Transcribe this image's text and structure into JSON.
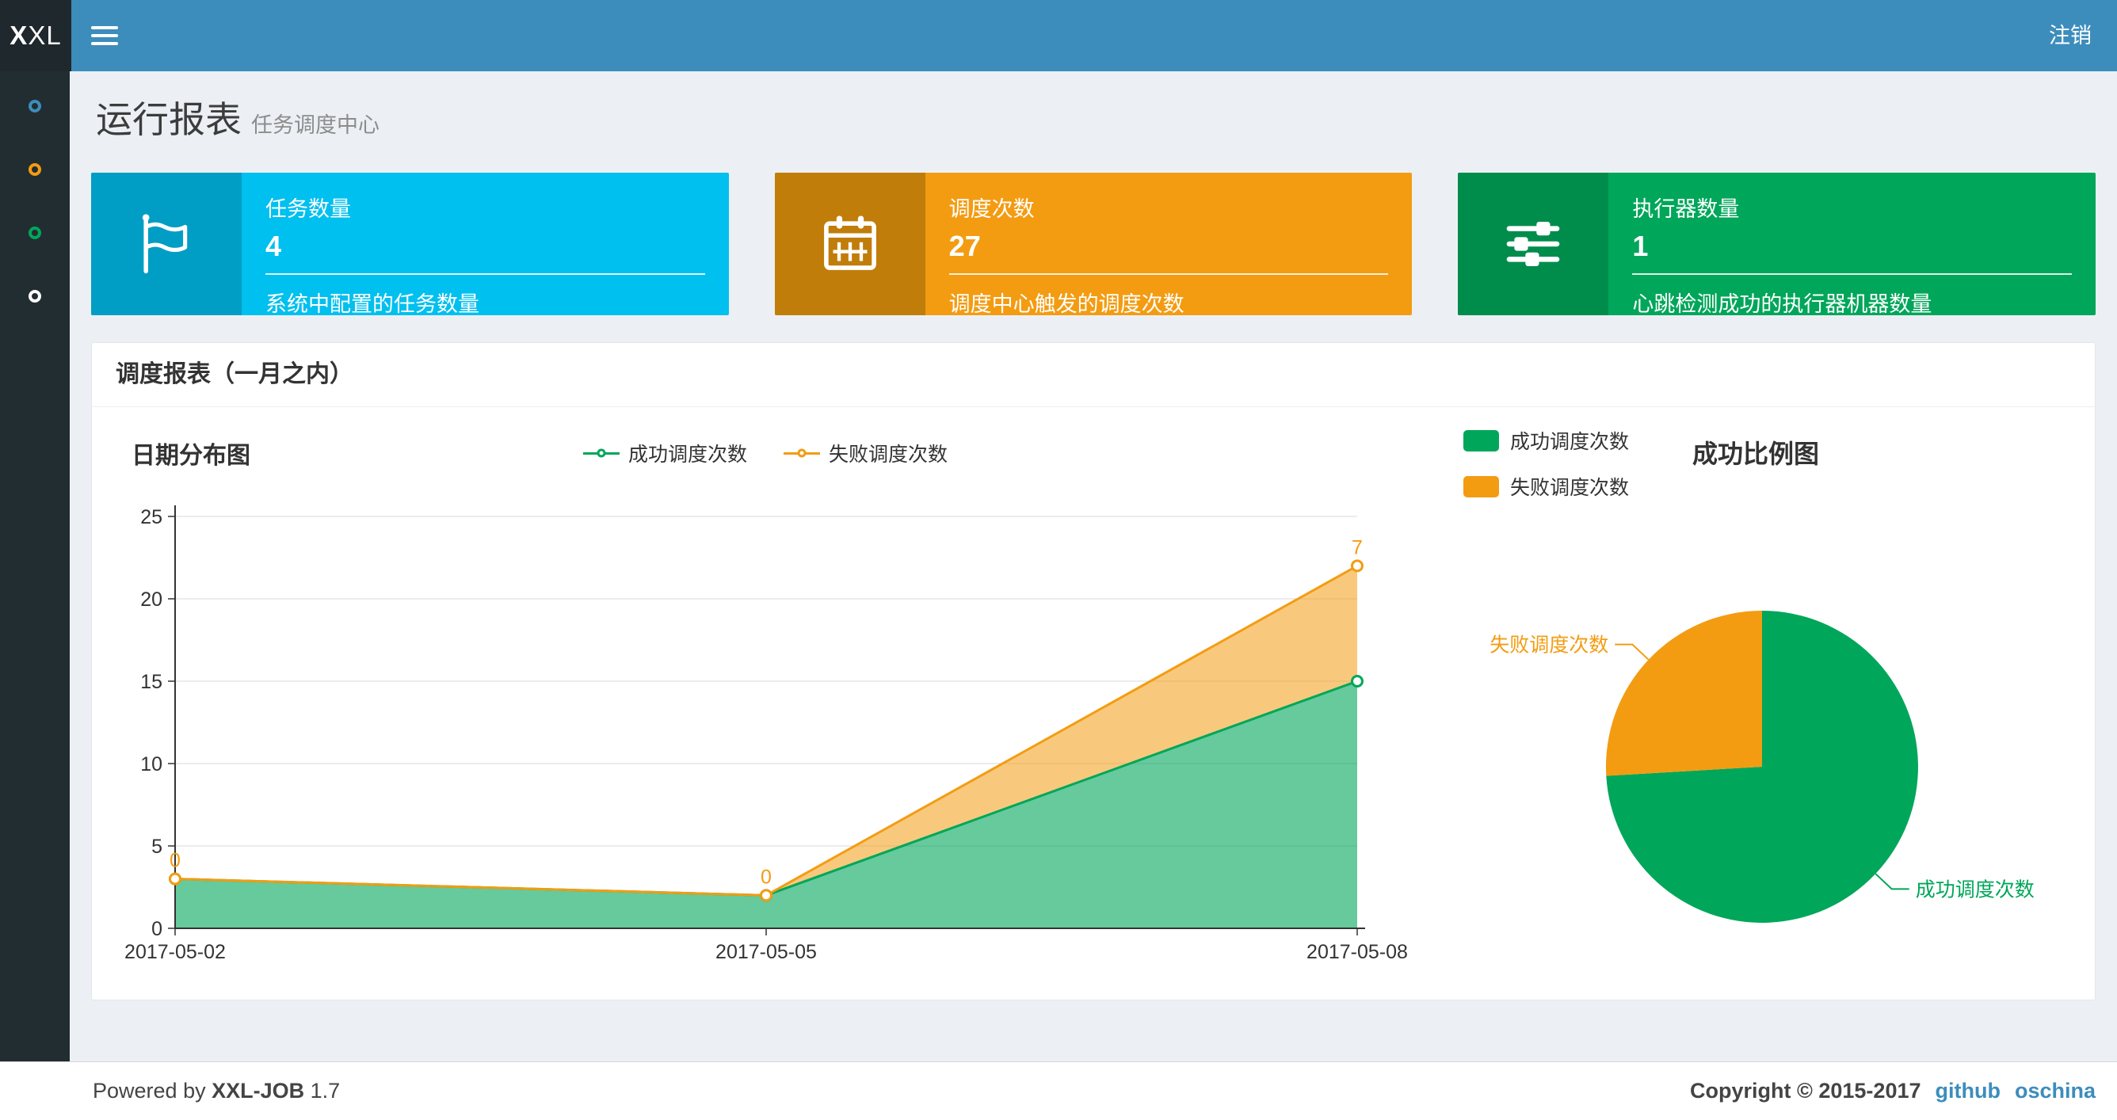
{
  "theme": {
    "header_bg": "#3c8dbc",
    "sidebar_bg": "#222d32",
    "content_bg": "#ecf0f5",
    "link_color": "#3c8dbc"
  },
  "header": {
    "logo_bold": "X",
    "logo_rest": "XL",
    "logout": "注销"
  },
  "sidebar": {
    "items": [
      {
        "color": "#3c8dbc"
      },
      {
        "color": "#f39c12"
      },
      {
        "color": "#00a65a"
      },
      {
        "color": "#ffffff"
      }
    ]
  },
  "page": {
    "title": "运行报表",
    "subtitle": "任务调度中心"
  },
  "info_boxes": [
    {
      "title": "任务数量",
      "value": "4",
      "desc": "系统中配置的任务数量",
      "color": "#00c0ef",
      "icon_color": "#009ec4",
      "icon": "flag-icon"
    },
    {
      "title": "调度次数",
      "value": "27",
      "desc": "调度中心触发的调度次数",
      "color": "#f39c12",
      "icon_color": "#c17d0a",
      "icon": "calendar-icon"
    },
    {
      "title": "执行器数量",
      "value": "1",
      "desc": "心跳检测成功的执行器机器数量",
      "color": "#00a65a",
      "icon_color": "#008d4c",
      "icon": "sliders-icon"
    }
  ],
  "panel": {
    "title": "调度报表（一月之内）"
  },
  "chart_data": [
    {
      "type": "area",
      "title": "日期分布图",
      "x": [
        "2017-05-02",
        "2017-05-05",
        "2017-05-08"
      ],
      "stacked": true,
      "grid": true,
      "legend_position": "top-center",
      "ylim": [
        0,
        25
      ],
      "yticks": [
        0,
        5,
        10,
        15,
        20,
        25
      ],
      "series": [
        {
          "name": "成功调度次数",
          "values": [
            3,
            2,
            15
          ],
          "color": "#00a65a"
        },
        {
          "name": "失败调度次数",
          "values": [
            0,
            0,
            7
          ],
          "color": "#f39c12",
          "labels": [
            "0",
            "0",
            "7"
          ]
        }
      ]
    },
    {
      "type": "pie",
      "title": "成功比例图",
      "legend_position": "top-left",
      "slices": [
        {
          "name": "成功调度次数",
          "value": 20,
          "color": "#00a65a"
        },
        {
          "name": "失败调度次数",
          "value": 7,
          "color": "#f39c12"
        }
      ]
    }
  ],
  "footer": {
    "powered_prefix": "Powered by",
    "brand": "XXL-JOB",
    "version": "1.7",
    "copyright": "Copyright © 2015-2017",
    "links": [
      "github",
      "oschina"
    ]
  }
}
